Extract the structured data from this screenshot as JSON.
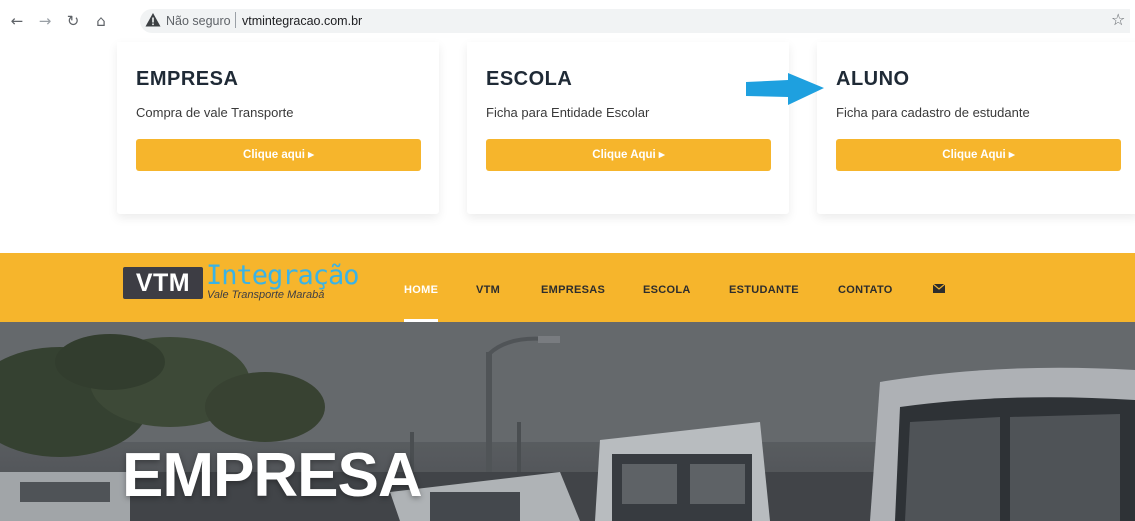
{
  "browser": {
    "security_label": "Não seguro",
    "url": "vtmintegracao.com.br"
  },
  "cards": [
    {
      "title": "EMPRESA",
      "description": "Compra de vale Transporte",
      "button_label": "Clique aqui ▸"
    },
    {
      "title": "ESCOLA",
      "description": "Ficha para Entidade Escolar",
      "button_label": "Clique Aqui ▸"
    },
    {
      "title": "ALUNO",
      "description": "Ficha para cadastro de estudante",
      "button_label": "Clique Aqui ▸"
    }
  ],
  "navbar": {
    "logo_box": "VTM",
    "logo_name": "Integração",
    "logo_tagline": "Vale Transporte Marabá",
    "menu": [
      "HOME",
      "VTM",
      "EMPRESAS",
      "ESCOLA",
      "ESTUDANTE",
      "CONTATO"
    ],
    "active_item": "HOME",
    "accent_color": "#f6b52c"
  },
  "hero": {
    "title": "EMPRESA"
  }
}
